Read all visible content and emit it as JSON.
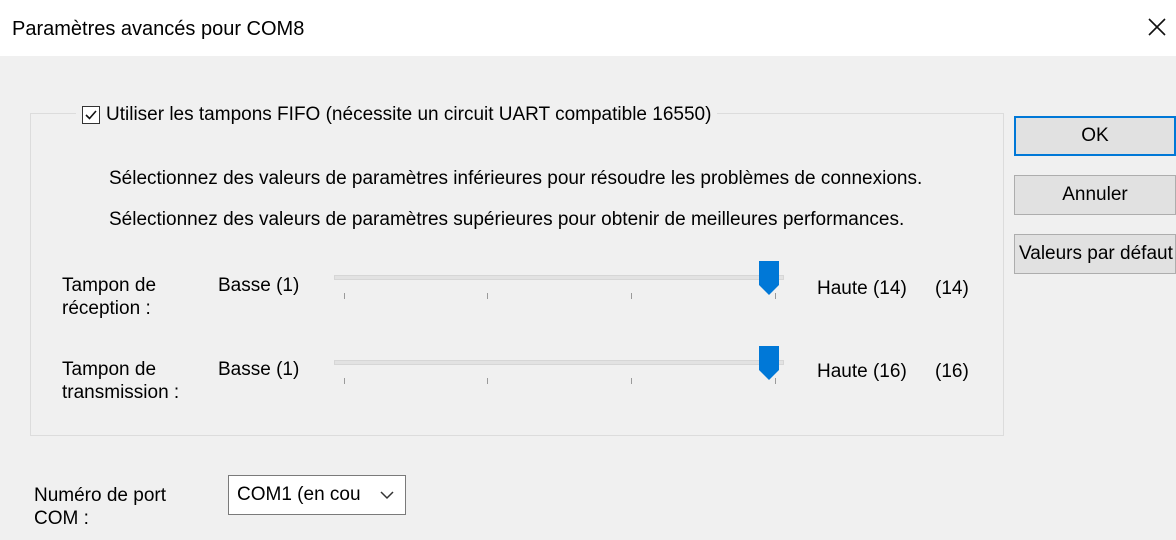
{
  "window": {
    "title": "Paramètres avancés pour COM8",
    "close_icon": "close-icon"
  },
  "fifo": {
    "checked": true,
    "label": "Utiliser les tampons FIFO (nécessite un circuit UART compatible 16550)"
  },
  "info": {
    "line1": "Sélectionnez des valeurs de paramètres inférieures pour résoudre les problèmes de connexions.",
    "line2": "Sélectionnez des valeurs de paramètres supérieures pour obtenir de meilleures performances."
  },
  "receive_buffer": {
    "label_line1": "Tampon de",
    "label_line2": "réception :",
    "low_label": "Basse (1)",
    "high_label": "Haute (14)",
    "value_display": "(14)",
    "min": 1,
    "max": 14,
    "value": 14
  },
  "transmit_buffer": {
    "label_line1": "Tampon de",
    "label_line2": "transmission :",
    "low_label": "Basse (1)",
    "high_label": "Haute (16)",
    "value_display": "(16)",
    "min": 1,
    "max": 16,
    "value": 16
  },
  "buttons": {
    "ok": "OK",
    "cancel": "Annuler",
    "defaults": "Valeurs par défaut"
  },
  "com_port": {
    "label_line1": "Numéro de port",
    "label_line2": "COM :",
    "selected": "COM1 (en cou"
  },
  "colors": {
    "accent": "#0078d7",
    "dialog_background": "#f0f0f0",
    "button_background": "#e1e1e1"
  }
}
